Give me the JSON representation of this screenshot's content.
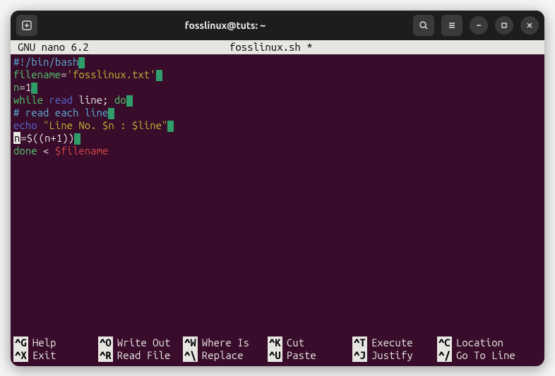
{
  "titlebar": {
    "title": "fosslinux@tuts: ~"
  },
  "nano": {
    "app": "GNU nano 6.2",
    "filename": "fosslinux.sh *"
  },
  "code": {
    "l1_shebang": "#!/bin/bash",
    "l2_var": "filename",
    "l2_eq": "=",
    "l2_str": "'fosslinux.txt'",
    "l3_var": "n",
    "l3_eq": "=",
    "l3_val": "1",
    "l4_kw1": "while",
    "l4_cmd": "read",
    "l4_txt": " line; ",
    "l4_kw2": "do",
    "l5_comment": "# read each line",
    "l6_cmd": "echo",
    "l6_str": " \"Line No. $n : $line\"",
    "l7_var": "n",
    "l7_expr": "=$((n+1))",
    "l8_kw": "done",
    "l8_txt": " < ",
    "l8_var": "$filename"
  },
  "footer": {
    "r1": {
      "k1": "^G",
      "l1": "Help",
      "k2": "^O",
      "l2": "Write Out",
      "k3": "^W",
      "l3": "Where Is",
      "k4": "^K",
      "l4": "Cut",
      "k5": "^T",
      "l5": "Execute",
      "k6": "^C",
      "l6": "Location"
    },
    "r2": {
      "k1": "^X",
      "l1": "Exit",
      "k2": "^R",
      "l2": "Read File",
      "k3": "^\\",
      "l3": "Replace",
      "k4": "^U",
      "l4": "Paste",
      "k5": "^J",
      "l5": "Justify",
      "k6": "^/",
      "l6": "Go To Line"
    }
  }
}
